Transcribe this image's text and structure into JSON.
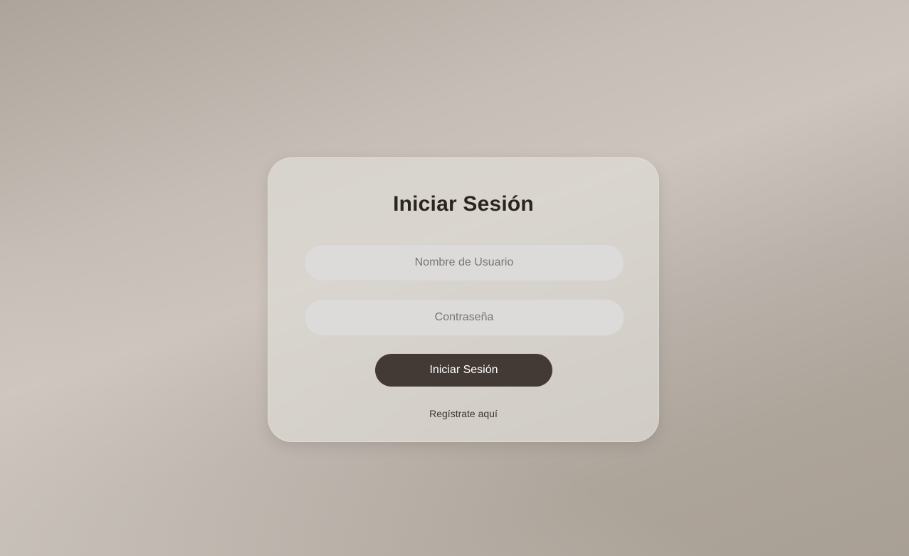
{
  "login": {
    "title": "Iniciar Sesión",
    "username_placeholder": "Nombre de Usuario",
    "password_placeholder": "Contraseña",
    "submit_label": "Iniciar Sesión",
    "register_link": "Regístrate aquí"
  },
  "colors": {
    "button": "#433935",
    "title_text": "#2b2522",
    "field_bg": "#dcdbda"
  }
}
